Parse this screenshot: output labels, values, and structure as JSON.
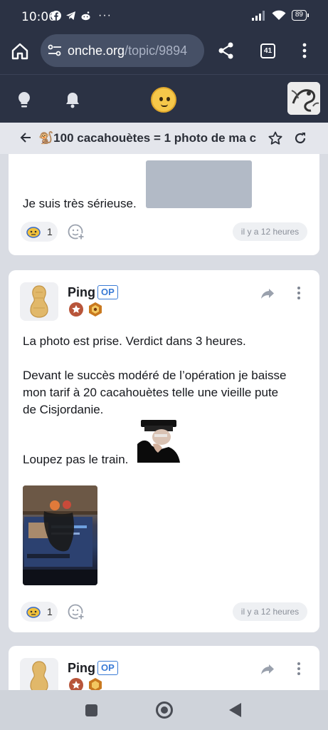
{
  "status_bar": {
    "time": "10:06",
    "battery": "89",
    "icons": [
      "facebook-icon",
      "telegram-icon",
      "reddit-icon",
      "more-dots-icon",
      "signal-icon",
      "wifi-icon",
      "battery-icon"
    ]
  },
  "browser": {
    "url_host": "onche.org",
    "url_path": "/topic/9894",
    "tab_count": "41"
  },
  "topic": {
    "title": "🐒100 cacahouètes = 1 photo de ma c"
  },
  "posts": [
    {
      "text": "Je suis très sérieuse.",
      "reaction_count": "1",
      "time": "il y a 12 heures"
    },
    {
      "author": "Ping",
      "op_label": "OP",
      "paragraphs": [
        "La photo est prise. Verdict dans 3 heures.",
        "Devant le succès modéré de l’opération je baisse",
        "mon tarif à 20 cacahouètes telle une vieille pute",
        "de Cisjordanie.",
        "Loupez pas le train."
      ],
      "reaction_count": "1",
      "time": "il y a 12 heures"
    },
    {
      "author": "Ping",
      "op_label": "OP"
    }
  ],
  "colors": {
    "header_bg": "#2b3244",
    "accent_blue": "#3a7bd5",
    "page_bg": "#d9dce3"
  }
}
